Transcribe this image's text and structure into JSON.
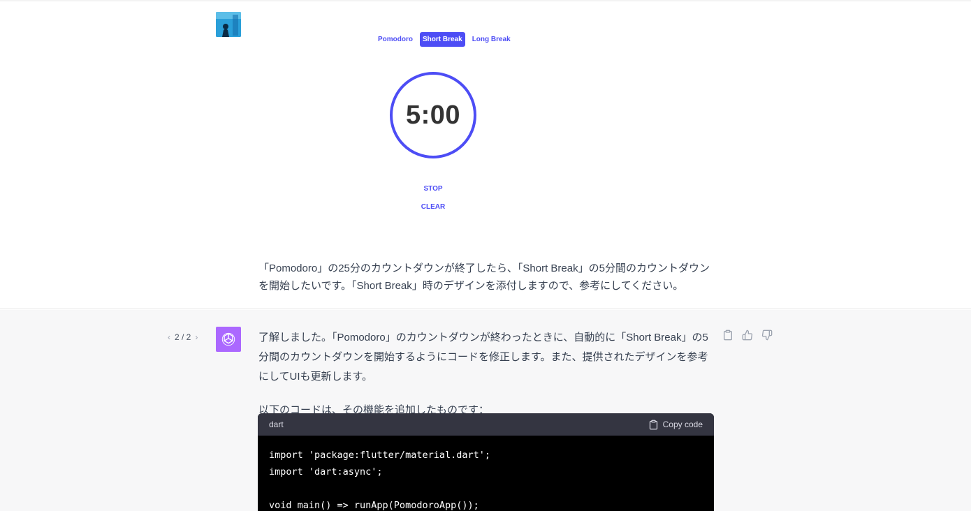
{
  "user_message": {
    "design": {
      "tabs": [
        {
          "label": "Pomodoro",
          "active": false
        },
        {
          "label": "Short Break",
          "active": true
        },
        {
          "label": "Long Break",
          "active": false
        }
      ],
      "timer": "5:00",
      "stop_label": "STOP",
      "clear_label": "CLEAR",
      "accent_color": "#4d4df5"
    },
    "text": "「Pomodoro」の25分のカウントダウンが終了したら、「Short Break」の5分間のカウントダウンを開始したいです。「Short Break」時のデザインを添付しますので、参考にしてください。"
  },
  "assistant_message": {
    "pager": {
      "current": "2 / 2",
      "prev_icon": "chevron-left",
      "next_icon": "chevron-right"
    },
    "avatar_color": "#ab68ff",
    "paragraphs": [
      "了解しました。「Pomodoro」のカウントダウンが終わったときに、自動的に「Short Break」の5分間のカウントダウンを開始するようにコードを修正します。また、提供されたデザインを参考にしてUIも更新します。",
      "以下のコードは、その機能を追加したものです："
    ],
    "code": {
      "language": "dart",
      "copy_label": "Copy code",
      "lines": [
        "import 'package:flutter/material.dart';",
        "import 'dart:async';",
        "",
        "void main() => runApp(PomodoroApp());"
      ]
    },
    "actions": [
      "clipboard-icon",
      "thumbs-up-icon",
      "thumbs-down-icon"
    ]
  }
}
